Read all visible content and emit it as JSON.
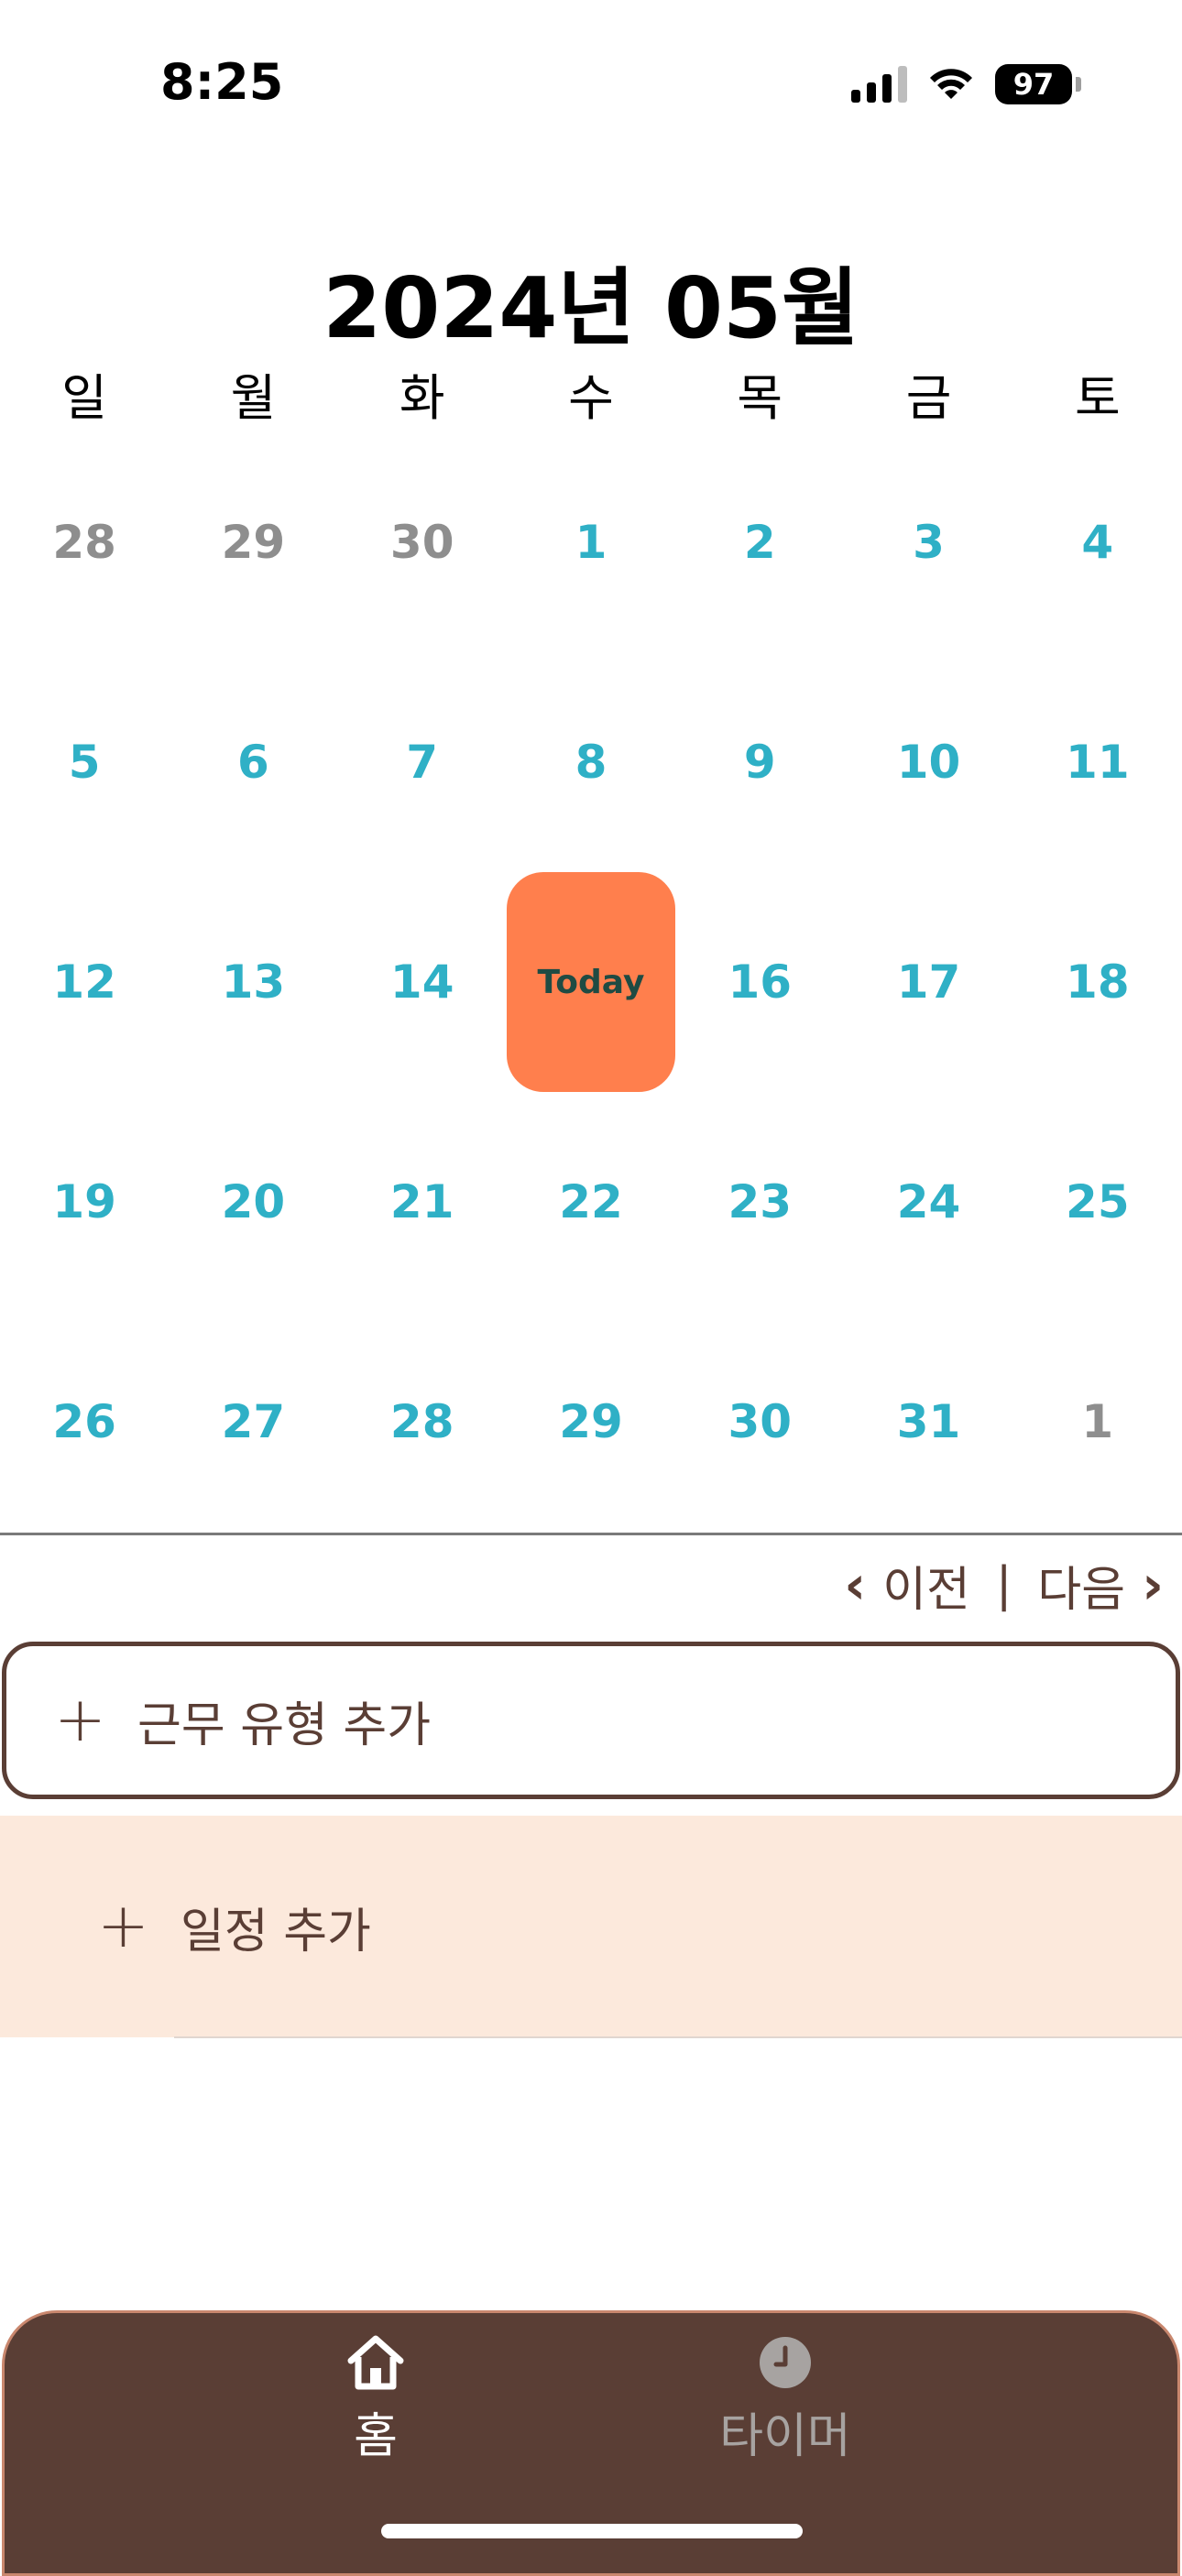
{
  "status_bar": {
    "time": "8:25",
    "battery": "97",
    "icons": [
      "signal-icon",
      "wifi-icon",
      "battery-icon"
    ]
  },
  "calendar": {
    "title": "2024년 05월",
    "weekdays": [
      "일",
      "월",
      "화",
      "수",
      "목",
      "금",
      "토"
    ],
    "weeks": [
      [
        {
          "day": "28",
          "other": true
        },
        {
          "day": "29",
          "other": true
        },
        {
          "day": "30",
          "other": true
        },
        {
          "day": "1"
        },
        {
          "day": "2"
        },
        {
          "day": "3"
        },
        {
          "day": "4"
        }
      ],
      [
        {
          "day": "5"
        },
        {
          "day": "6"
        },
        {
          "day": "7"
        },
        {
          "day": "8"
        },
        {
          "day": "9"
        },
        {
          "day": "10"
        },
        {
          "day": "11"
        }
      ],
      [
        {
          "day": "12"
        },
        {
          "day": "13"
        },
        {
          "day": "14"
        },
        {
          "day": "Today",
          "today": true
        },
        {
          "day": "16"
        },
        {
          "day": "17"
        },
        {
          "day": "18"
        }
      ],
      [
        {
          "day": "19"
        },
        {
          "day": "20"
        },
        {
          "day": "21"
        },
        {
          "day": "22"
        },
        {
          "day": "23"
        },
        {
          "day": "24"
        },
        {
          "day": "25"
        }
      ],
      [
        {
          "day": "26"
        },
        {
          "day": "27"
        },
        {
          "day": "28"
        },
        {
          "day": "29"
        },
        {
          "day": "30"
        },
        {
          "day": "31"
        },
        {
          "day": "1",
          "other": true
        }
      ]
    ],
    "colors": {
      "current_month_day": "#2fb0c6",
      "other_month_day": "#8e8e8e",
      "today_bg": "#ff7f4d",
      "today_text": "#1f4b43"
    }
  },
  "month_nav": {
    "prev_label": "이전",
    "separator": "|",
    "next_label": "다음"
  },
  "actions": {
    "add_shift_label": "근무 유형 추가",
    "add_schedule_label": "일정 추가"
  },
  "tab_bar": {
    "tabs": [
      {
        "label": "홈",
        "icon": "home-icon",
        "active": true
      },
      {
        "label": "타이머",
        "icon": "clock-icon",
        "active": false
      }
    ],
    "background": "#5a3e35"
  }
}
